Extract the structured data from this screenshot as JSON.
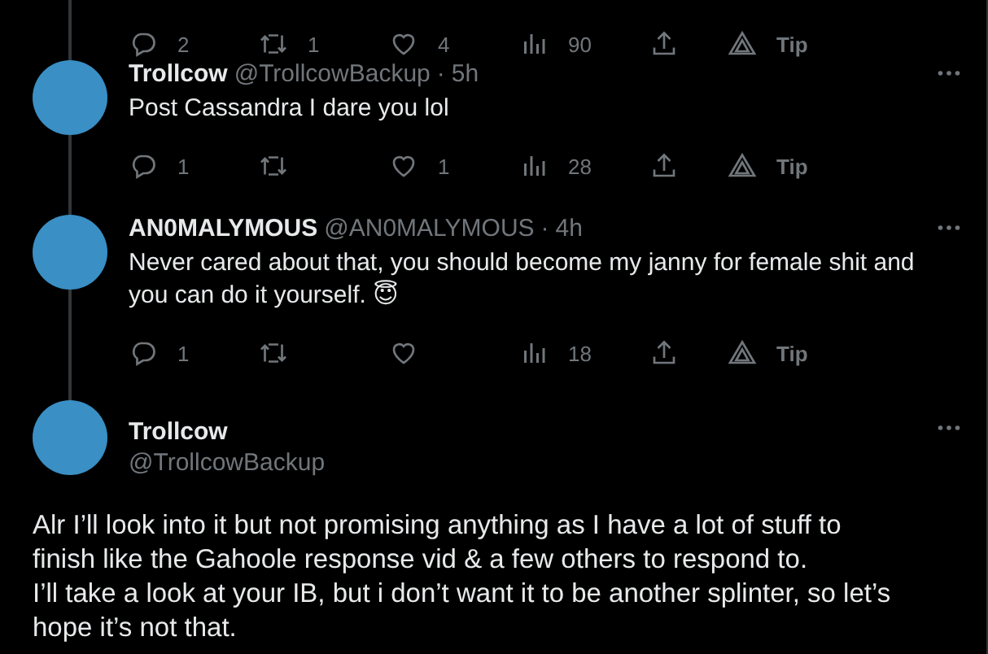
{
  "top_actions": {
    "replies": "2",
    "reposts": "1",
    "likes": "4",
    "views": "90",
    "tip": "Tip"
  },
  "replies": [
    {
      "name": "Trollcow",
      "handle": "@TrollcowBackup",
      "separator": "·",
      "time": "5h",
      "text": "Post Cassandra I dare you lol",
      "actions": {
        "replies": "1",
        "likes": "1",
        "views": "28",
        "tip": "Tip"
      }
    },
    {
      "name": "AN0MALYMOUS",
      "handle": "@AN0MALYMOUS",
      "separator": "·",
      "time": "4h",
      "text": "Never cared about that, you should become my janny for female shit and\nyou can do it yourself. 😇",
      "actions": {
        "replies": "1",
        "views": "18",
        "tip": "Tip"
      }
    }
  ],
  "main_tweet": {
    "name": "Trollcow",
    "handle": "@TrollcowBackup",
    "paragraphs": [
      "Alr I’ll look into it but not promising anything as I have a lot of stuff to\nfinish like the Gahoole response vid & a few others to respond to.",
      "I’ll take a look at your IB, but i don’t want it to be another splinter, so let’s\nhope it’s not that."
    ]
  }
}
